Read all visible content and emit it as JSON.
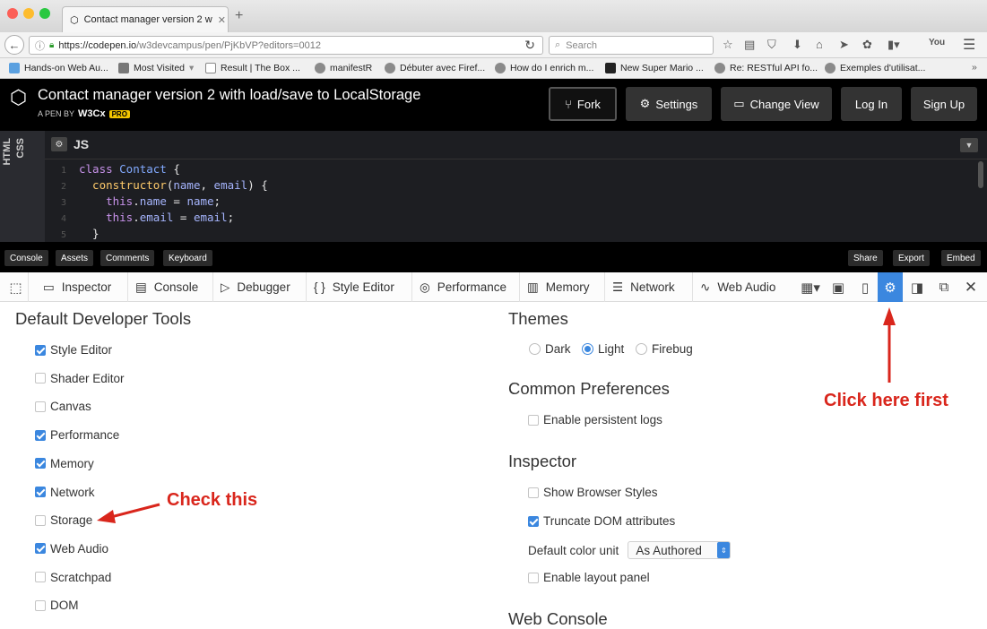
{
  "browser": {
    "tab_title": "Contact manager version 2 w",
    "url_prefix": "https://codepen.io",
    "url_path": "/w3devcampus/pen/PjKbVP?editors=0012",
    "search_placeholder": "Search",
    "bookmarks": [
      "Hands-on Web Au...",
      "Most Visited",
      "Result | The Box ...",
      "manifestR",
      "Débuter avec Firef...",
      "How do I enrich m...",
      "New Super Mario ...",
      "Re: RESTful API fo...",
      "Exemples d'utilisat..."
    ]
  },
  "codepen": {
    "title": "Contact manager version 2 with load/save to LocalStorage",
    "byline_prefix": "A PEN BY",
    "author": "W3Cx",
    "pro_badge": "PRO",
    "buttons": {
      "fork": "Fork",
      "settings": "Settings",
      "change_view": "Change View",
      "login": "Log In",
      "signup": "Sign Up"
    },
    "side_tabs": [
      "CSS",
      "HTML"
    ],
    "editor_label": "JS",
    "line_numbers": [
      "1",
      "2",
      "3",
      "4",
      "5"
    ],
    "code_lines": [
      {
        "parts": [
          [
            "class ",
            "kw"
          ],
          [
            "Contact",
            "cls"
          ],
          [
            " {",
            "pl"
          ]
        ]
      },
      {
        "parts": [
          [
            "  constructor",
            "fn"
          ],
          [
            "(",
            "pl"
          ],
          [
            "name",
            "var"
          ],
          [
            ", ",
            "pl"
          ],
          [
            "email",
            "var"
          ],
          [
            ") {",
            "pl"
          ]
        ]
      },
      {
        "parts": [
          [
            "    this",
            "kw"
          ],
          [
            ".",
            "pl"
          ],
          [
            "name",
            "var"
          ],
          [
            " = ",
            "pl"
          ],
          [
            "name",
            "var"
          ],
          [
            ";",
            "pl"
          ]
        ]
      },
      {
        "parts": [
          [
            "    this",
            "kw"
          ],
          [
            ".",
            "pl"
          ],
          [
            "email",
            "var"
          ],
          [
            " = ",
            "pl"
          ],
          [
            "email",
            "var"
          ],
          [
            ";",
            "pl"
          ]
        ]
      },
      {
        "parts": [
          [
            "  }",
            "pl"
          ]
        ]
      }
    ],
    "footer_left": [
      "Console",
      "Assets",
      "Comments",
      "Keyboard"
    ],
    "footer_right": [
      "Share",
      "Export",
      "Embed"
    ]
  },
  "devtools": {
    "tabs": [
      "Inspector",
      "Console",
      "Debugger",
      "Style Editor",
      "Performance",
      "Memory",
      "Network",
      "Web Audio"
    ],
    "default_tools_heading": "Default Developer Tools",
    "default_tools": [
      {
        "label": "Style Editor",
        "checked": true
      },
      {
        "label": "Shader Editor",
        "checked": false
      },
      {
        "label": "Canvas",
        "checked": false
      },
      {
        "label": "Performance",
        "checked": true
      },
      {
        "label": "Memory",
        "checked": true
      },
      {
        "label": "Network",
        "checked": true
      },
      {
        "label": "Storage",
        "checked": false
      },
      {
        "label": "Web Audio",
        "checked": true
      },
      {
        "label": "Scratchpad",
        "checked": false
      },
      {
        "label": "DOM",
        "checked": false
      }
    ],
    "themes_heading": "Themes",
    "themes": [
      {
        "label": "Dark",
        "selected": false
      },
      {
        "label": "Light",
        "selected": true
      },
      {
        "label": "Firebug",
        "selected": false
      }
    ],
    "common_heading": "Common Preferences",
    "persistent_logs": {
      "label": "Enable persistent logs",
      "checked": false
    },
    "inspector_heading": "Inspector",
    "inspector_opts": [
      {
        "label": "Show Browser Styles",
        "checked": false
      },
      {
        "label": "Truncate DOM attributes",
        "checked": true
      }
    ],
    "color_unit_label": "Default color unit",
    "color_unit_value": "As Authored",
    "layout_panel": {
      "label": "Enable layout panel",
      "checked": false
    },
    "webconsole_heading": "Web Console"
  },
  "annotations": {
    "click_here": "Click here first",
    "check_this": "Check this",
    "color": "#d9261c"
  }
}
